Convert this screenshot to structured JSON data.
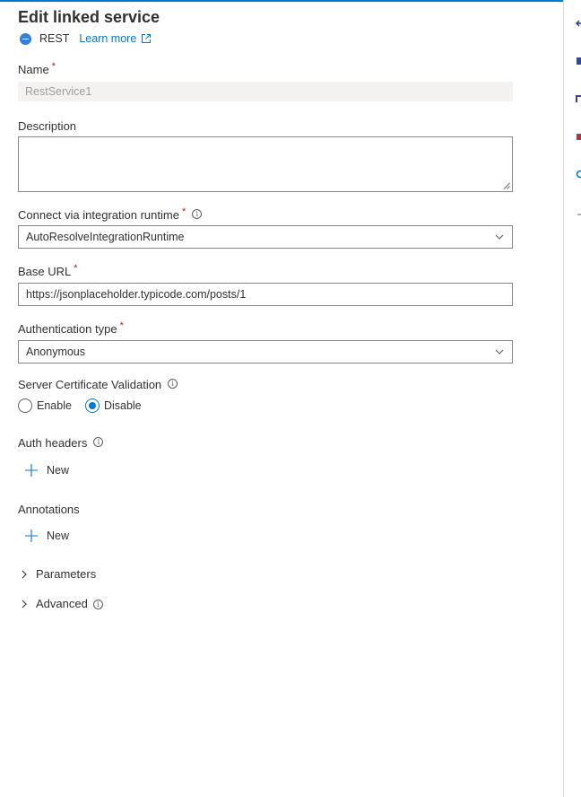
{
  "panel": {
    "title": "Edit linked service",
    "service_type": "REST",
    "learn_more": "Learn more"
  },
  "fields": {
    "name": {
      "label": "Name",
      "value": "RestService1"
    },
    "description": {
      "label": "Description",
      "value": ""
    },
    "integration_runtime": {
      "label": "Connect via integration runtime",
      "value": "AutoResolveIntegrationRuntime"
    },
    "base_url": {
      "label": "Base URL",
      "value": "https://jsonplaceholder.typicode.com/posts/1"
    },
    "auth_type": {
      "label": "Authentication type",
      "value": "Anonymous"
    },
    "server_cert": {
      "label": "Server Certificate Validation",
      "options": [
        "Enable",
        "Disable"
      ],
      "selected": "Disable"
    }
  },
  "auth_headers": {
    "label": "Auth headers",
    "new_label": "New"
  },
  "annotations": {
    "label": "Annotations",
    "new_label": "New"
  },
  "sections": {
    "parameters": "Parameters",
    "advanced": "Advanced"
  },
  "symbols": {
    "required": "*",
    "info": "i"
  },
  "colors": {
    "accent": "#0078d4",
    "required": "#a4262c",
    "disabled_bg": "#f3f2f1"
  },
  "icons": {
    "service_logo": "rest-service-icon",
    "external": "external-link-icon",
    "dropdown": "chevron-down-icon",
    "add": "plus-icon",
    "expand": "chevron-right-icon",
    "info": "info-icon"
  }
}
